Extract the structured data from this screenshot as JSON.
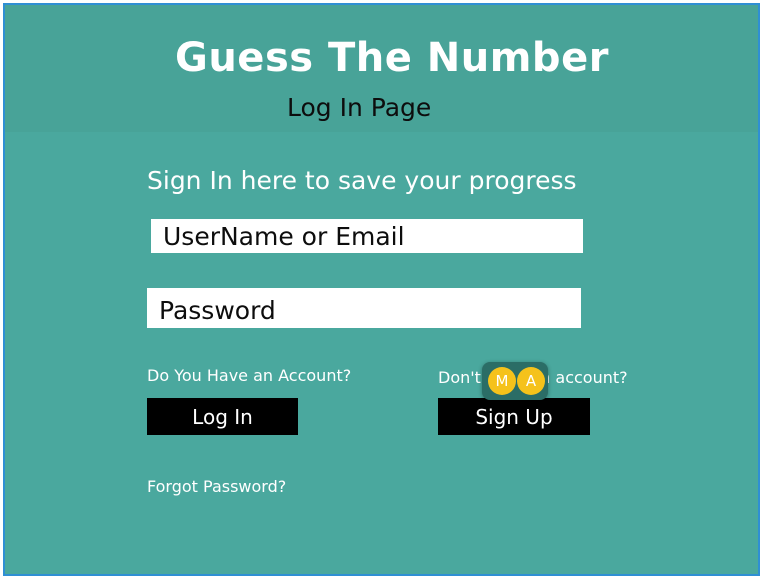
{
  "header": {
    "app_title": "Guess The Number",
    "page_title": "Log In Page"
  },
  "form": {
    "prompt": "Sign In here to save your progress",
    "username_placeholder": "UserName or Email",
    "password_placeholder": "Password",
    "have_account_text": "Do You Have an Account?",
    "login_label": "Log In",
    "no_account_text": "Don't have an account?",
    "signup_label": "Sign Up",
    "forgot_password_label": "Forgot Password?"
  },
  "overlay": {
    "badge_1": "M",
    "badge_2": "A"
  },
  "colors": {
    "background": "#4aa89e",
    "header": "#48a398",
    "border": "#2f8fd4",
    "button": "#000000",
    "badge": "#f5c21b"
  }
}
